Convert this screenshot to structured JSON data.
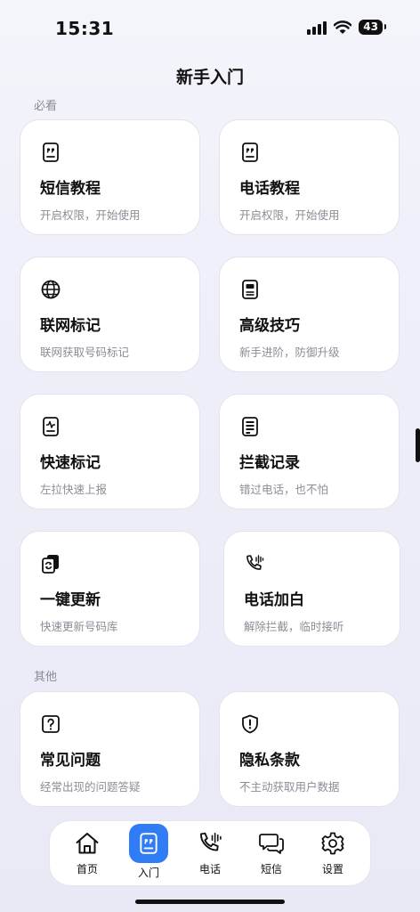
{
  "status": {
    "time": "15:31",
    "battery": "43"
  },
  "page": {
    "title": "新手入门"
  },
  "sections": {
    "must_see": "必看",
    "other": "其他"
  },
  "cards": [
    {
      "title": "短信教程",
      "sub": "开启权限，开始使用",
      "icon": "message-doc-icon"
    },
    {
      "title": "电话教程",
      "sub": "开启权限，开始使用",
      "icon": "message-doc-icon"
    },
    {
      "title": "联网标记",
      "sub": "联网获取号码标记",
      "icon": "globe-icon"
    },
    {
      "title": "高级技巧",
      "sub": "新手进阶，防御升级",
      "icon": "document-icon"
    },
    {
      "title": "快速标记",
      "sub": "左拉快速上报",
      "icon": "pulse-doc-icon"
    },
    {
      "title": "拦截记录",
      "sub": "错过电话，也不怕",
      "icon": "list-doc-icon"
    },
    {
      "title": "一键更新",
      "sub": "快速更新号码库",
      "icon": "refresh-doc-icon"
    },
    {
      "title": "电话加白",
      "sub": "解除拦截，临时接听",
      "icon": "phone-wave-icon"
    },
    {
      "title": "常见问题",
      "sub": "经常出现的问题答疑",
      "icon": "question-icon"
    },
    {
      "title": "隐私条款",
      "sub": "不主动获取用户数据",
      "icon": "shield-icon"
    }
  ],
  "tabs": [
    {
      "label": "首页",
      "icon": "home-icon"
    },
    {
      "label": "入门",
      "icon": "message-doc-icon",
      "active": true
    },
    {
      "label": "电话",
      "icon": "phone-wave-icon"
    },
    {
      "label": "短信",
      "icon": "chat-bubbles-icon"
    },
    {
      "label": "设置",
      "icon": "gear-icon"
    }
  ],
  "colors": {
    "accent": "#2f7cf6",
    "text": "#111111",
    "subtext": "#8c8c96"
  }
}
